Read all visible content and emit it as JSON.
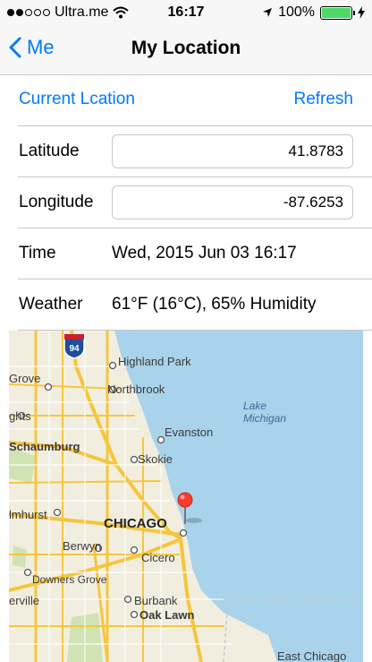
{
  "status_bar": {
    "carrier": "Ultra.me",
    "time": "16:17",
    "battery": "100%"
  },
  "nav": {
    "back_label": "Me",
    "title": "My Location"
  },
  "actions": {
    "current_location": "Current Lcation",
    "refresh": "Refresh"
  },
  "fields": {
    "latitude_label": "Latitude",
    "latitude_value": "41.8783",
    "longitude_label": "Longitude",
    "longitude_value": "-87.6253",
    "time_label": "Time",
    "time_value": "Wed, 2015 Jun 03 16:17",
    "weather_label": "Weather",
    "weather_value": "61°F (16°C), 65% Humidity"
  },
  "map": {
    "highway_shield": "94",
    "places": [
      "Highland Park",
      "Grove",
      "Northbrook",
      "ghts",
      "Lake",
      "Michigan",
      "Evanston",
      "Schaumburg",
      "Skokie",
      "lmhurst",
      "CHICAGO",
      "Berwyn",
      "Cicero",
      "Downers Grove",
      "erville",
      "Burbank",
      "Oak Lawn",
      "East Chicago"
    ],
    "water_color": "#a9d3ea",
    "land_color": "#f2eedf",
    "road_color": "#f5c63c",
    "pin_color": "#ff3b30"
  }
}
